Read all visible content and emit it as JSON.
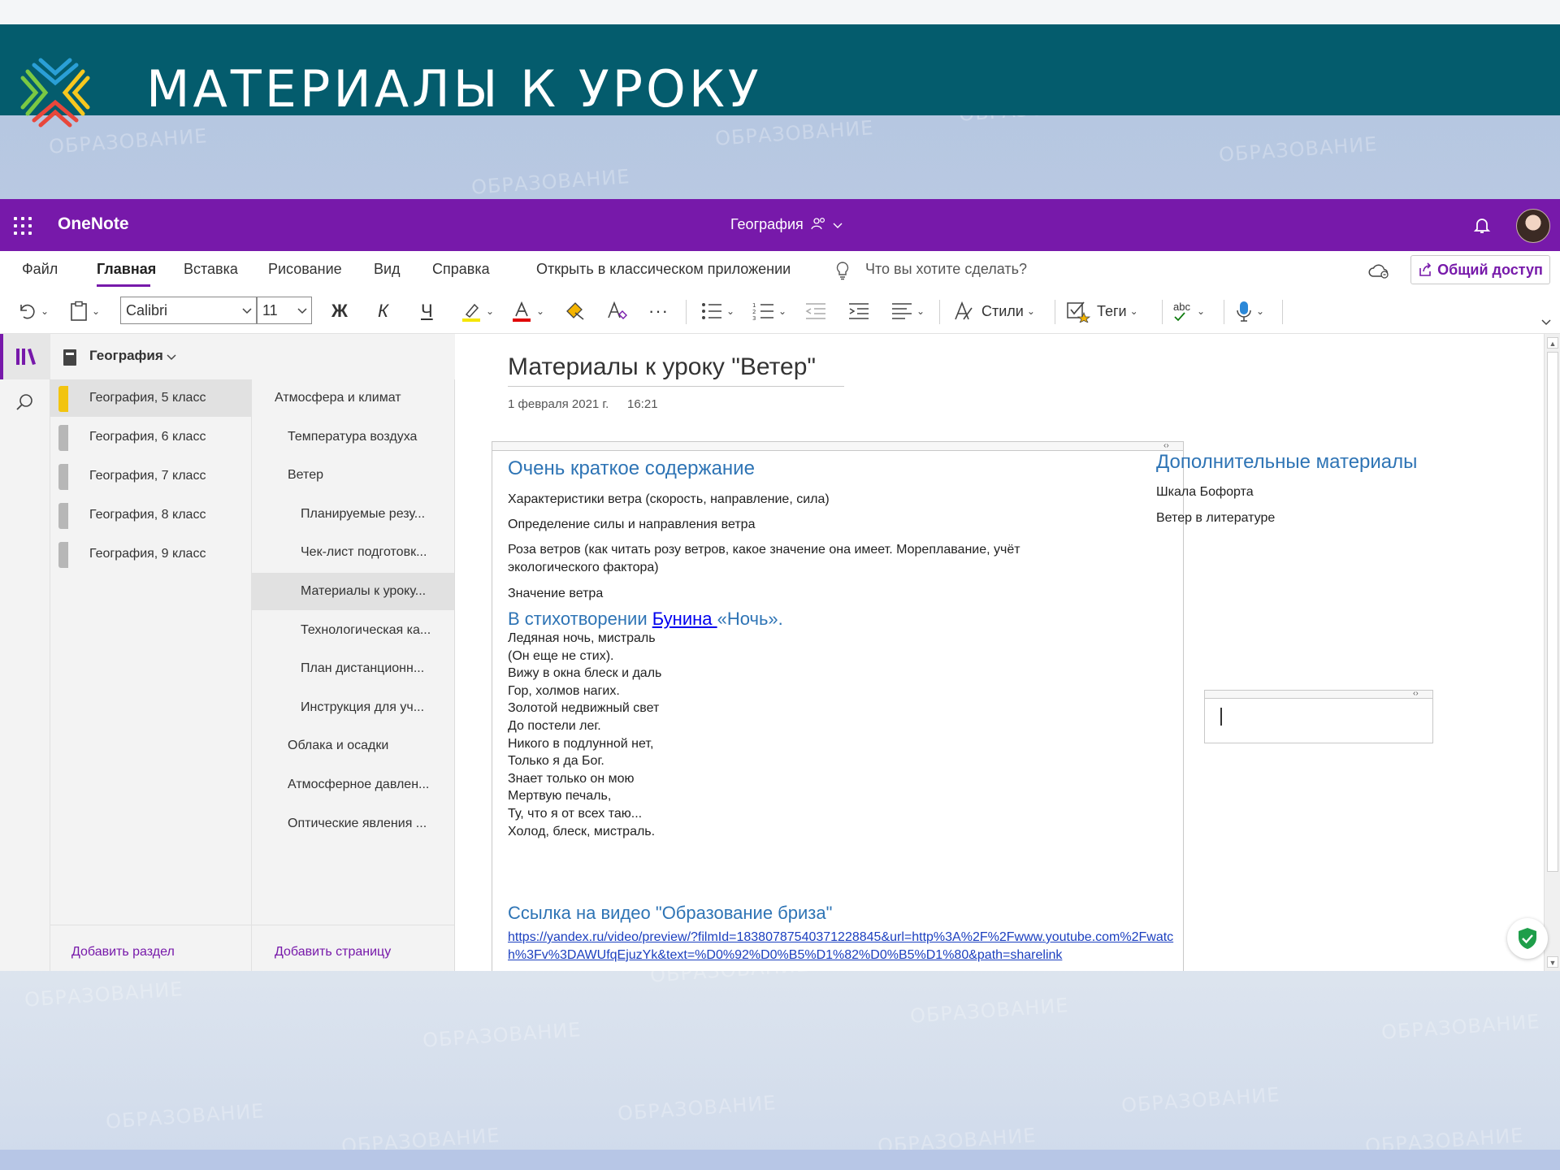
{
  "slide": {
    "title": "МАТЕРИАЛЫ К УРОКУ",
    "watermark_text": "ОБРАЗОВАНИЕ"
  },
  "app": {
    "name": "OneNote",
    "document_title": "География",
    "icons": {
      "waffle": "app-launcher-icon",
      "notebook_member": "people-icon",
      "bell": "notification-bell-icon",
      "avatar": "user-avatar"
    }
  },
  "menu": {
    "items": [
      "Файл",
      "Главная",
      "Вставка",
      "Рисование",
      "Вид",
      "Справка"
    ],
    "active": "Главная",
    "open_classic": "Открыть в классическом приложении",
    "search_placeholder": "Что вы хотите сделать?",
    "share_label": "Общий доступ"
  },
  "toolbar": {
    "font_name": "Calibri",
    "font_size": "11",
    "bold": "Ж",
    "italic": "К",
    "underline": "Ч",
    "more": "···",
    "styles_label": "Стили",
    "tags_label": "Теги",
    "spell_label": "abc"
  },
  "notebook": {
    "name": "География",
    "sections": [
      {
        "name": "География, 5 класс",
        "color": "#f2c40f"
      },
      {
        "name": "География, 6 класс",
        "color": "#b7b7b7"
      },
      {
        "name": "География, 7 класс",
        "color": "#b7b7b7"
      },
      {
        "name": "География, 8 класс",
        "color": "#b7b7b7"
      },
      {
        "name": "География, 9 класс",
        "color": "#b7b7b7"
      }
    ],
    "add_section": "Добавить раздел",
    "pages": [
      {
        "name": "Атмосфера и климат",
        "level": 0
      },
      {
        "name": "Температура воздуха",
        "level": 1
      },
      {
        "name": "Ветер",
        "level": 1
      },
      {
        "name": "Планируемые резу...",
        "level": 2
      },
      {
        "name": "Чек-лист подготовк...",
        "level": 2
      },
      {
        "name": "Материалы к уроку...",
        "level": 2
      },
      {
        "name": "Технологическая ка...",
        "level": 2
      },
      {
        "name": "План дистанционн...",
        "level": 2
      },
      {
        "name": "Инструкция для уч...",
        "level": 2
      },
      {
        "name": "Облака и осадки",
        "level": 1
      },
      {
        "name": "Атмосферное давлен...",
        "level": 1
      },
      {
        "name": "Оптические явления ...",
        "level": 1
      }
    ],
    "selected_page": "Материалы к уроку...",
    "add_page": "Добавить страницу"
  },
  "page": {
    "title": "Материалы к уроку \"Ветер\"",
    "date": "1 февраля 2021 г.",
    "time": "16:21",
    "heading1": "Очень краткое содержание",
    "points": [
      "Характеристики ветра (скорость, направление, сила)",
      "Определение силы и направления ветра",
      "Роза ветров (как читать розу ветров, какое значение она имеет. Мореплавание, учёт экологического фактора)",
      "Значение ветра"
    ],
    "poem_heading_prefix": "В стихотворении ",
    "poem_heading_link": "Бунина ",
    "poem_heading_suffix": "«Ночь».",
    "poem": [
      "Ледяная ночь, мистраль",
      "(Он еще не стих).",
      "Вижу в окна блеск и даль",
      "Гор, холмов нагих.",
      "Золотой недвижный свет",
      "До постели лег.",
      "Никого в подлунной нет,",
      "Только я да Бог.",
      "Знает только он мою",
      "Мертвую печаль,",
      "Ту, что я от всех таю...",
      "Холод, блеск, мистраль."
    ],
    "video_heading": "Ссылка на видео \"Образование бриза\"",
    "video_url": "https://yandex.ru/video/preview/?filmId=18380787540371228845&url=http%3A%2F%2Fwww.youtube.com%2Fwatch%3Fv%3DAWUfqEjuzYk&text=%D0%92%D0%B5%D1%82%D0%B5%D1%80&path=sharelink",
    "side_heading": "Дополнительные материалы",
    "side_items": [
      "Шкала Бофорта",
      "Ветер в литературе"
    ]
  },
  "colors": {
    "onenote_purple": "#7719aa",
    "slide_header": "#045c6d",
    "heading_blue": "#2e74b5",
    "link_blue": "#1b3fbf"
  }
}
